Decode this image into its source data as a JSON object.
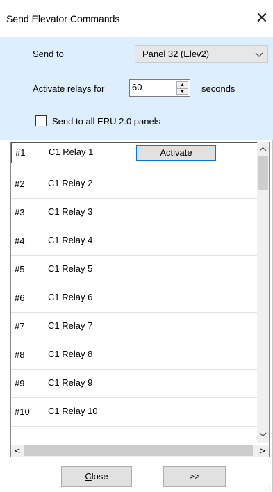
{
  "window": {
    "title": "Send Elevator Commands",
    "close_glyph": "✕"
  },
  "form": {
    "send_to_label": "Send to",
    "send_to_value": "Panel 32 (Elev2)",
    "activate_label": "Activate relays for",
    "activate_value": "60",
    "seconds_label": "seconds",
    "all_panels_label": "Send to all ERU 2.0 panels",
    "all_panels_checked": false
  },
  "relays": {
    "activate_label": "Activate",
    "rows": [
      {
        "num": "#1",
        "name": "C1 Relay 1"
      },
      {
        "num": "#2",
        "name": "C1 Relay 2"
      },
      {
        "num": "#3",
        "name": "C1 Relay 3"
      },
      {
        "num": "#4",
        "name": "C1 Relay 4"
      },
      {
        "num": "#5",
        "name": "C1 Relay 5"
      },
      {
        "num": "#6",
        "name": "C1 Relay 6"
      },
      {
        "num": "#7",
        "name": "C1 Relay 7"
      },
      {
        "num": "#8",
        "name": "C1 Relay 8"
      },
      {
        "num": "#9",
        "name": "C1 Relay 9"
      },
      {
        "num": "#10",
        "name": "C1 Relay 10"
      }
    ]
  },
  "footer": {
    "close_label_first": "C",
    "close_label_rest": "lose",
    "next_label": ">>"
  },
  "colors": {
    "panel_bg": "#ddeeff",
    "focus_border": "#0078d7"
  }
}
